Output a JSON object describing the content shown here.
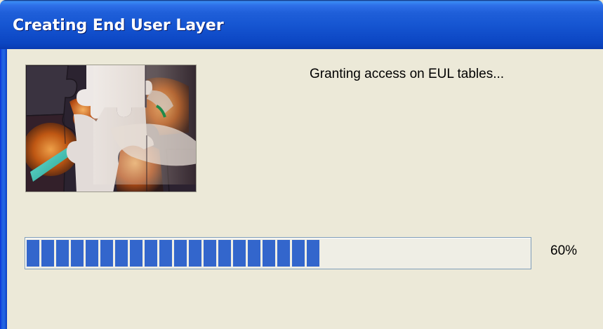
{
  "window": {
    "title": "Creating End User Layer"
  },
  "status": {
    "message": "Granting access on EUL tables..."
  },
  "progress": {
    "value": 0.6,
    "label": "60%"
  },
  "image": {
    "icon": "puzzle-pieces-image"
  },
  "colors": {
    "titlebar": "#1656D2",
    "background": "#ECE9D8",
    "progress_fill": "#3366CC"
  }
}
